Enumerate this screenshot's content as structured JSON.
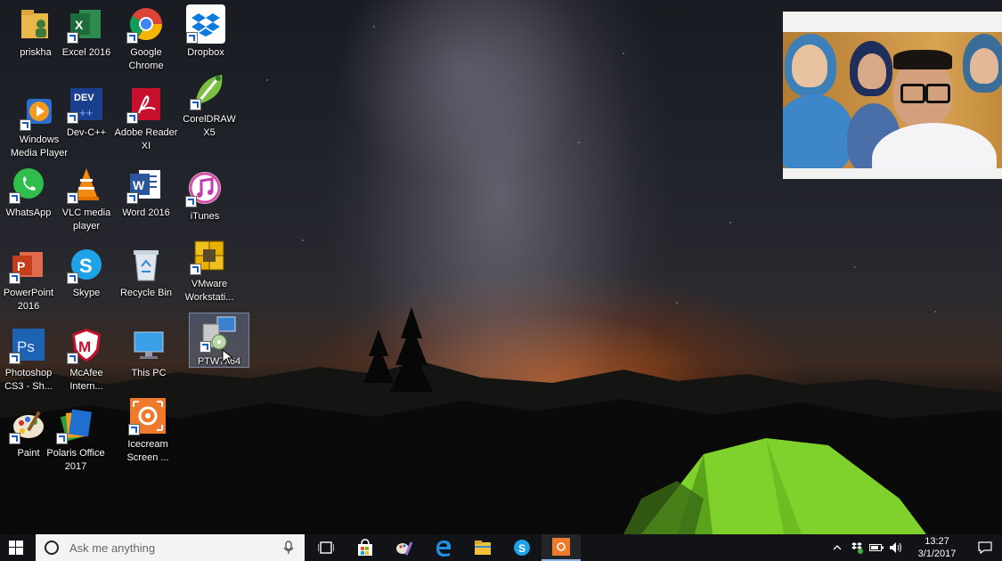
{
  "desktop": {
    "icons": [
      {
        "label": "priskha",
        "icon": "user-folder-icon"
      },
      {
        "label": "Excel 2016",
        "icon": "excel-icon"
      },
      {
        "label": "Google Chrome",
        "icon": "chrome-icon"
      },
      {
        "label": "Dropbox",
        "icon": "dropbox-icon"
      },
      {
        "label": "Windows Media Player",
        "icon": "media-player-icon"
      },
      {
        "label": "Dev-C++",
        "icon": "devcpp-icon"
      },
      {
        "label": "Adobe Reader XI",
        "icon": "adobe-reader-icon"
      },
      {
        "label": "CorelDRAW X5",
        "icon": "coreldraw-icon"
      },
      {
        "label": "WhatsApp",
        "icon": "whatsapp-icon"
      },
      {
        "label": "VLC media player",
        "icon": "vlc-icon"
      },
      {
        "label": "Word 2016",
        "icon": "word-icon"
      },
      {
        "label": "iTunes",
        "icon": "itunes-icon"
      },
      {
        "label": "PowerPoint 2016",
        "icon": "powerpoint-icon"
      },
      {
        "label": "Skype",
        "icon": "skype-icon"
      },
      {
        "label": "Recycle Bin",
        "icon": "recycle-bin-icon"
      },
      {
        "label": "VMware Workstati...",
        "icon": "vmware-icon"
      },
      {
        "label": "Photoshop CS3 - Sh...",
        "icon": "photoshop-icon"
      },
      {
        "label": "McAfee Intern...",
        "icon": "mcafee-icon"
      },
      {
        "label": "This PC",
        "icon": "this-pc-icon"
      },
      {
        "label": "PTW7x64",
        "icon": "installer-icon"
      },
      {
        "label": "Paint",
        "icon": "paint-icon"
      },
      {
        "label": "Polaris Office 2017",
        "icon": "polaris-office-icon"
      },
      {
        "label": "Icecream Screen ...",
        "icon": "icecream-recorder-icon"
      }
    ],
    "selected_label": "PTW7x64"
  },
  "taskbar": {
    "search_placeholder": "Ask me anything",
    "pinned": [
      "task-view-icon",
      "store-icon",
      "paint-tools-icon",
      "edge-icon",
      "file-explorer-icon",
      "skype-icon",
      "icecream-recorder-icon"
    ],
    "clock_time": "13:27",
    "clock_date": "3/1/2017"
  },
  "colors": {
    "taskbar_bg": "#121418",
    "search_bg": "#f3f3f3",
    "selection": "#7896be"
  }
}
